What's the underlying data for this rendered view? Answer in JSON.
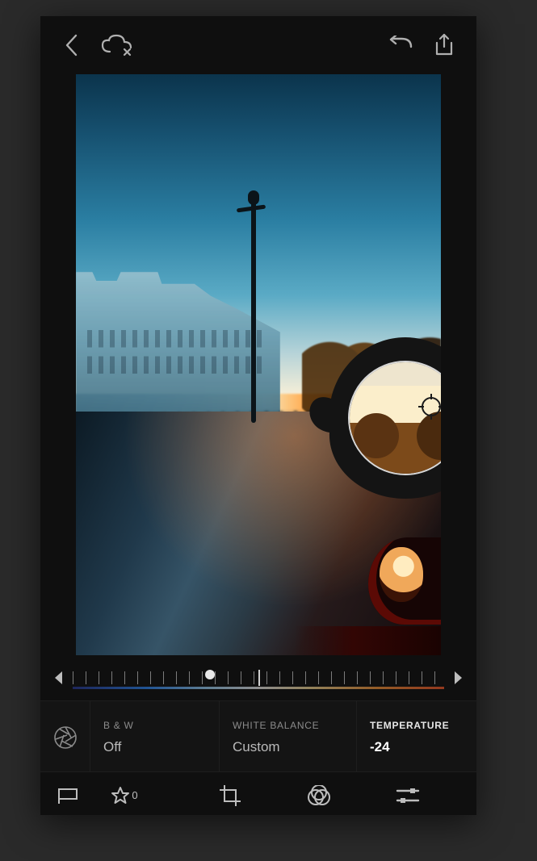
{
  "topbar": {
    "back_icon": "back-chevron",
    "cloud_icon": "cloud-delete",
    "undo_icon": "undo",
    "share_icon": "share"
  },
  "ruler": {
    "left_icon": "triangle-left",
    "right_icon": "triangle-right",
    "handle_percent": 37
  },
  "picker": {
    "confirm_icon": "checkmark"
  },
  "params": {
    "aperture_icon": "aperture",
    "bw": {
      "label": "B & W",
      "value": "Off"
    },
    "wb": {
      "label": "WHITE BALANCE",
      "value": "Custom"
    },
    "temp": {
      "label": "TEMPERATURE",
      "value": "-24"
    }
  },
  "bottombar": {
    "flag_icon": "flag",
    "star_icon": "star",
    "star_count": "0",
    "crop_icon": "crop",
    "filter_icon": "overlap-circles",
    "adjust_icon": "sliders"
  }
}
